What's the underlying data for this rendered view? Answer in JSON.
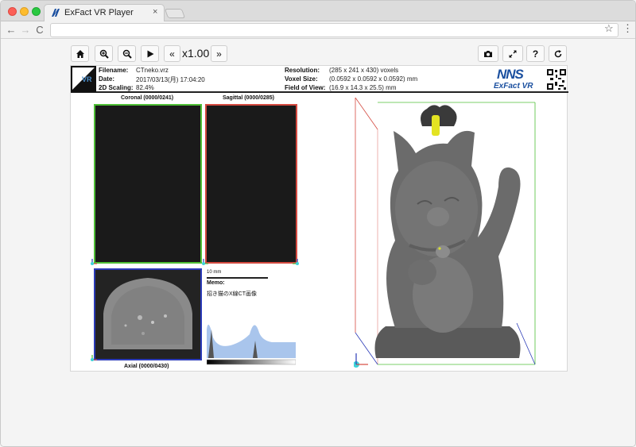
{
  "browser": {
    "tab_title": "ExFact VR Player",
    "tab_close": "×",
    "nav_back": "←",
    "nav_forward": "→",
    "nav_reload": "C",
    "star": "☆",
    "menu": "⋮"
  },
  "app_toolbar": {
    "home_icon": "home-icon",
    "zoom_in_icon": "zoom-in-icon",
    "zoom_out_icon": "zoom-out-icon",
    "play_icon": "play-icon",
    "slower": "«",
    "speed": "x1.00",
    "faster": "»",
    "camera_icon": "camera-icon",
    "fullscreen_icon": "fullscreen-icon",
    "help": "?",
    "reset_icon": "reset-icon"
  },
  "info": {
    "filename_label": "Filename:",
    "filename": "CTneko.vrz",
    "date_label": "Date:",
    "date": "2017/03/13(月) 17:04:20",
    "scaling_label": "2D Scaling:",
    "scaling": "82.4%",
    "resolution_label": "Resolution:",
    "resolution": "(285 x 241 x 430) voxels",
    "voxel_label": "Voxel Size:",
    "voxel": "(0.0592 x 0.0592 x 0.0592) mm",
    "fov_label": "Field of View:",
    "fov": "(16.9 x 14.3 x 25.5) mm",
    "logo_vr": "VR",
    "brand_mark": "NNS",
    "brand_text": "ExFact VR"
  },
  "views": {
    "coronal": "Coronal (0000/0241)",
    "sagittal": "Sagittal (0000/0285)",
    "axial": "Axial (0000/0430)",
    "scale": "10 mm",
    "memo_label": "Memo:",
    "memo": "招き猫のX線CT画像"
  },
  "colors": {
    "coronal_frame": "#4fbf36",
    "sagittal_frame": "#d44a40",
    "axial_frame": "#2b3bb8",
    "histogram_fill": "#a9c5ec"
  }
}
